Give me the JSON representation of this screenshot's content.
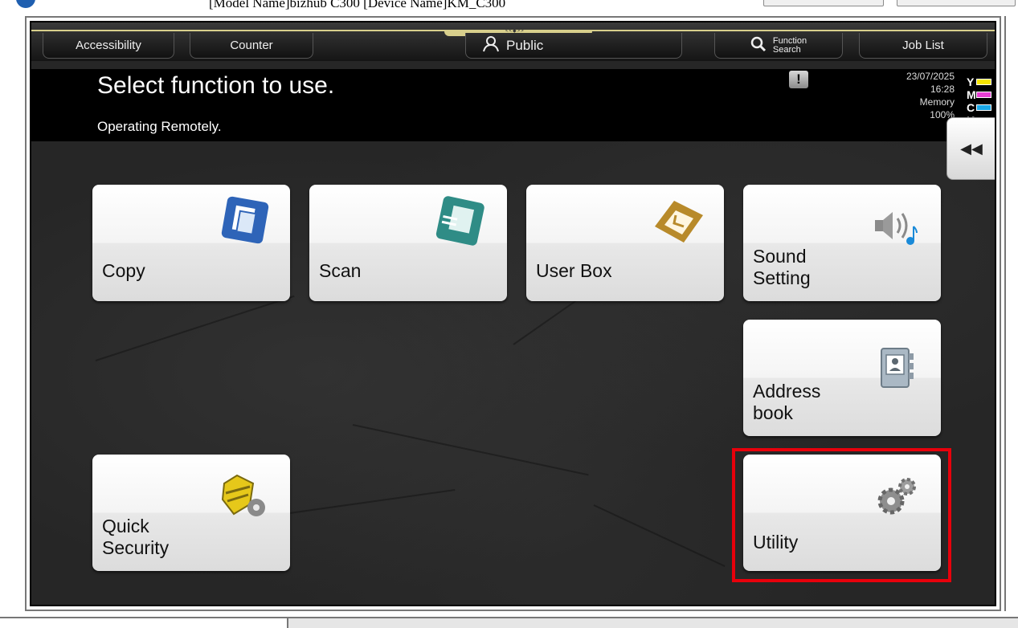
{
  "window": {
    "device_title": "[Model Name]bizhub C300 [Device Name]KM_C300"
  },
  "tabs": {
    "accessibility": "Accessibility",
    "counter": "Counter",
    "public": "Public",
    "function_search_line1": "Function",
    "function_search_line2": "Search",
    "job_list": "Job List"
  },
  "header": {
    "title": "Select function to use.",
    "subtitle": "Operating Remotely.",
    "alert_icon": "!"
  },
  "status": {
    "date": "23/07/2025",
    "time": "16:28",
    "memory_label": "Memory",
    "memory_value": "100%",
    "toner": [
      {
        "letter": "Y",
        "color": "#f5e400"
      },
      {
        "letter": "M",
        "color": "#e83fd4"
      },
      {
        "letter": "C",
        "color": "#1aa8e8"
      },
      {
        "letter": "K",
        "color": "#222222"
      }
    ]
  },
  "collapse_button": "◀◀",
  "tiles": {
    "copy": "Copy",
    "scan": "Scan",
    "user_box": "User Box",
    "sound_line1": "Sound",
    "sound_line2": "Setting",
    "address_line1": "Address",
    "address_line2": "book",
    "quick_line1": "Quick",
    "quick_line2": "Security",
    "utility": "Utility"
  },
  "colors": {
    "highlight": "#e8000b",
    "accent_bar": "#d8cf8c"
  }
}
